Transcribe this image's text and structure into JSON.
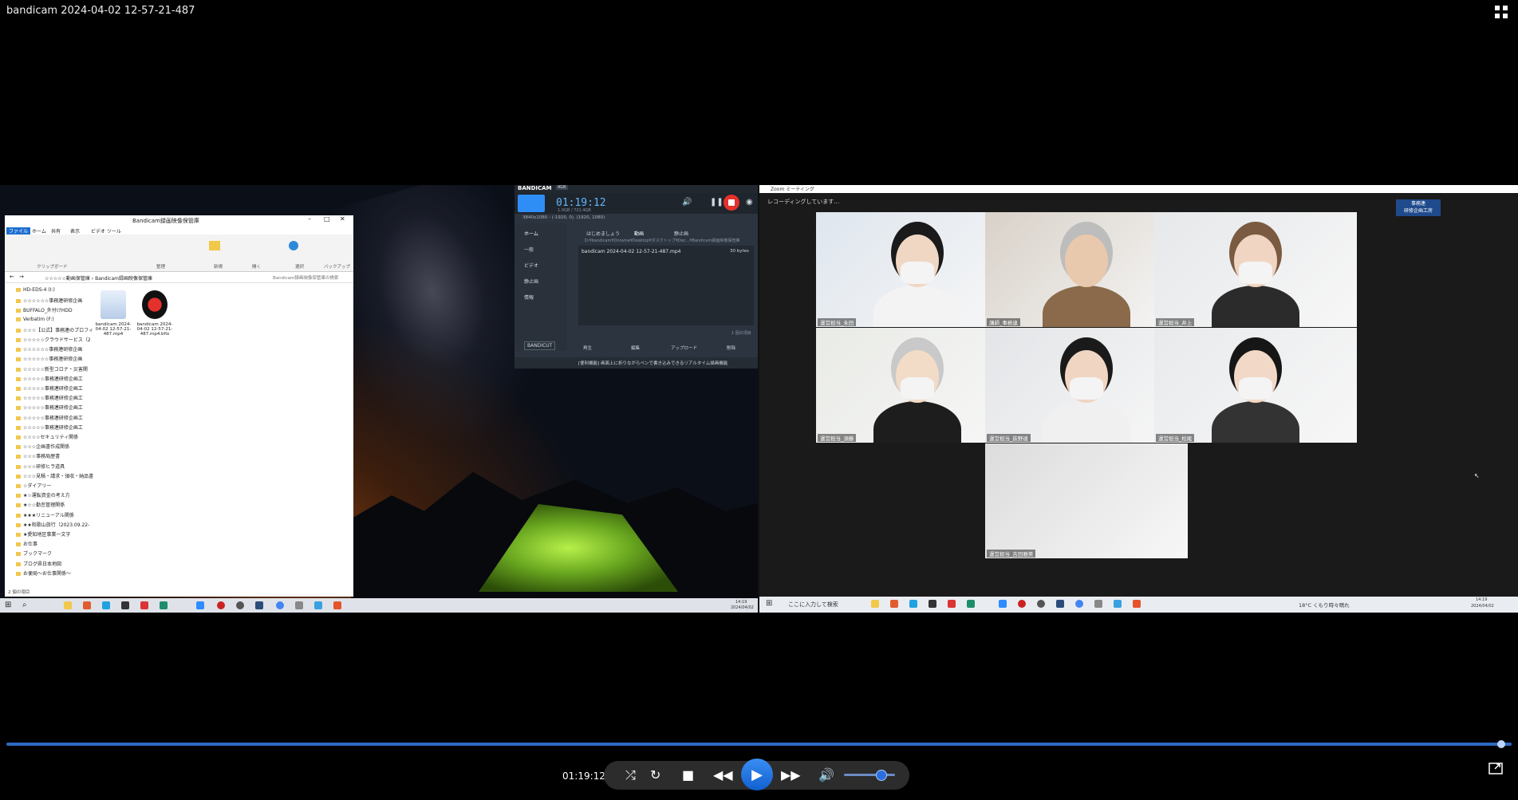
{
  "window": {
    "title": "bandicam 2024-04-02 12-57-21-487"
  },
  "player": {
    "time": "01:19:12",
    "progress": 0.993,
    "volume": 0.72
  },
  "explorer": {
    "title": "Bandicam録画映像保管庫",
    "tabs": [
      "ファイル",
      "ホーム",
      "共有",
      "表示",
      "ビデオ ツール"
    ],
    "ribbon_groups": [
      "クリップボード",
      "整理",
      "新規",
      "開く",
      "選択",
      "バックアップ"
    ],
    "address": "☆☆☆☆☆動画保管庫 › Bandicam録画映像保管庫",
    "search_placeholder": "Bandicam録画映像保管庫の検索",
    "tree": [
      "HD-EDS-4 (I:)",
      "☆☆☆☆☆☆事務連研修企画",
      "BUFFALO_外付けHDD",
      "Verbatim (F:)",
      "☆☆☆【公式】事務連のプロフィ",
      "☆☆☆☆☆クラウドサービス（2",
      "☆☆☆☆☆☆事務連研修企画",
      "☆☆☆☆☆☆事務連研修企画",
      "☆☆☆☆☆新型コロナ・災害関",
      "☆☆☆☆☆事務連研修企画工",
      "☆☆☆☆☆事務連研修企画工",
      "☆☆☆☆☆事務連研修企画工",
      "☆☆☆☆☆事務連研修企画工",
      "☆☆☆☆☆事務連研修企画工",
      "☆☆☆☆☆事務連研修企画工",
      "☆☆☆☆セキュリティ関係",
      "☆☆☆企画書作成関係",
      "☆☆☆事務局歴書",
      "☆☆☆研修ヒラ道具",
      "☆☆☆見積・請求・領収・納品書",
      "☆ダイアリー",
      "★☆運転資金の考え方",
      "★☆☆勤怠管理関係",
      "★★★リニューアル関係",
      "★★和歌山旅行（2023.09.22-",
      "★愛知地区事業一文字",
      "お仕事",
      "ブックマーク",
      "ブログ県日本地図",
      "お便局～お仕事関係～"
    ],
    "files": [
      {
        "name": "bandicam 2024-04-02 12-57-21-487.mp4"
      },
      {
        "name": "bandicam 2024-04-02 12-57-21-487.mp4.bfix"
      }
    ],
    "status": "2 個の項目"
  },
  "bandicam": {
    "logo": "BANDICAM",
    "tier": "4GB",
    "timer": "01:19:12",
    "subtimer": "1.0GB / 721.4GB",
    "resolution": "3840x1080 - (-1920, 0), (1920, 1080)",
    "nav": [
      "ホーム",
      "一般",
      "ビデオ",
      "静止画",
      "情報"
    ],
    "tabs": [
      "はじめましょう",
      "動画",
      "静止画"
    ],
    "path": "D:¥bandicam¥Onrame¥Desktop¥ダスクトップ¥Dec...¥Bandicam録画映像保管庫",
    "file": "bandicam 2024-04-02 12-57-21-487.mp4",
    "file_size": "30 bytes",
    "count": "1 個の項目",
    "buttons": [
      "再生",
      "編集",
      "アップロード",
      "削除"
    ],
    "bandicut": "BANDICUT",
    "footer": "[便利機能] 画面上に折りながらペンで書き込みできるリアルタイム描画機能"
  },
  "zoom": {
    "title": "Zoom ミーティング",
    "recording": "レコーディングしています…",
    "logo_line1": "事務連",
    "logo_line2": "研修企画工房",
    "participants": [
      {
        "name": "運営担当_永田"
      },
      {
        "name": "講師_事務連"
      },
      {
        "name": "運営担当_井上"
      },
      {
        "name": "運営担当_須藤"
      },
      {
        "name": "運営担当_荻野達"
      },
      {
        "name": "運営担当_松尾"
      },
      {
        "name": "運営担当_吉田雅美"
      }
    ],
    "search": "ここに入力して検索",
    "weather": "18°C くもり時々晴れ",
    "clock_time": "14:19",
    "clock_date": "2024/04/02"
  },
  "left_clock": {
    "time": "14:19",
    "date": "2024/04/02"
  }
}
